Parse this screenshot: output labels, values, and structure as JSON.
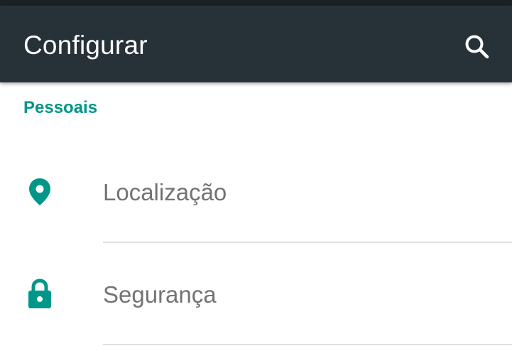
{
  "app_bar": {
    "title": "Configurar",
    "search_icon": "search-icon"
  },
  "section": {
    "header": "Pessoais"
  },
  "items": [
    {
      "label": "Localização",
      "icon": "location-pin-icon"
    },
    {
      "label": "Segurança",
      "icon": "lock-icon"
    }
  ],
  "colors": {
    "app_bar_bg": "#263238",
    "accent": "#009688",
    "item_text": "#737373",
    "divider": "#e0e0e0"
  }
}
